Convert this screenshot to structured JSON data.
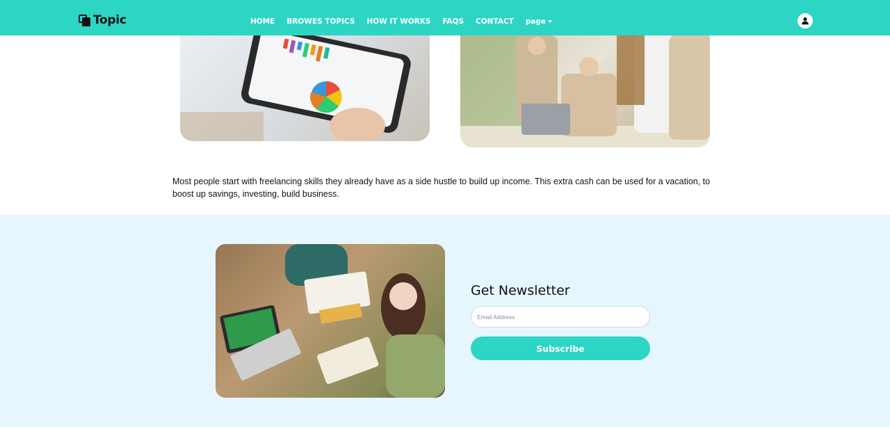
{
  "brand": {
    "name": "Topic",
    "icon": "layers-icon"
  },
  "nav": {
    "items": [
      {
        "label": "HOME"
      },
      {
        "label": "BROWES TOPICS"
      },
      {
        "label": "HOW IT WORKS"
      },
      {
        "label": "FAQS"
      },
      {
        "label": "CONTACT"
      }
    ],
    "dropdown_label": "page",
    "user_icon": "user-icon"
  },
  "content": {
    "paragraph": "Most people start with freelancing skills they already have as a side hustle to build up income. This extra cash can be used for a vacation, to boost up savings, investing, build business."
  },
  "newsletter": {
    "title": "Get Newsletter",
    "email_placeholder": "Email Address",
    "button_label": "Subscribe"
  },
  "colors": {
    "brand_accent": "#2cd5c4",
    "newsletter_bg": "#e6f6fd",
    "text": "#111111"
  }
}
